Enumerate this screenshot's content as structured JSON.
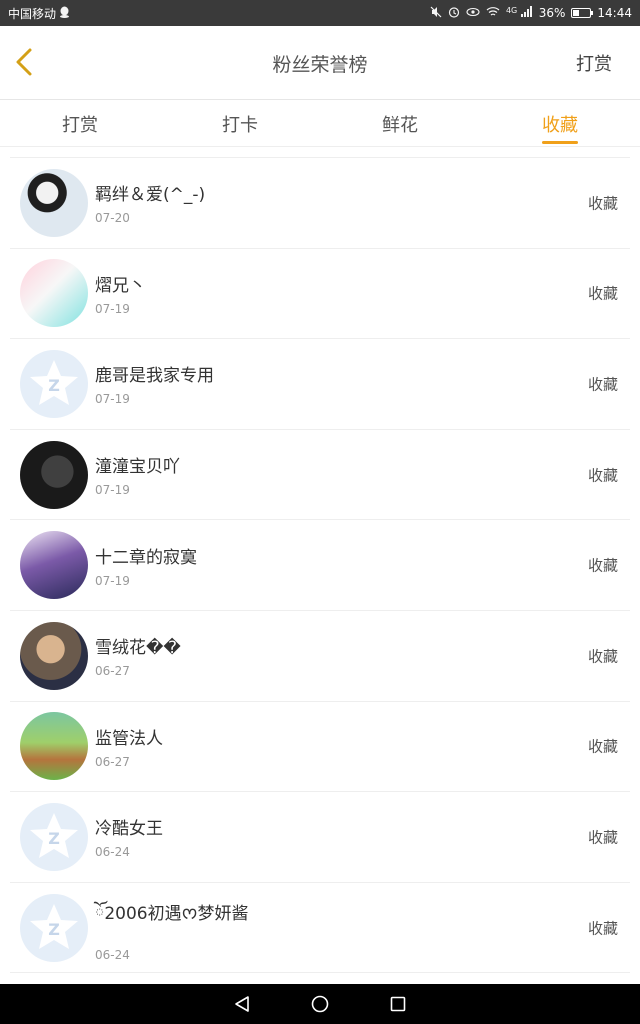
{
  "status_bar": {
    "carrier": "中国移动",
    "battery_percent": "36%",
    "battery_level": 0.36,
    "time": "14:44",
    "signal_label": "4G"
  },
  "header": {
    "title": "粉丝荣誉榜",
    "action": "打赏",
    "back_icon": "chevron-left-icon",
    "back_color": "#d4a017"
  },
  "tabs": [
    {
      "label": "打赏",
      "active": false
    },
    {
      "label": "打卡",
      "active": false
    },
    {
      "label": "鲜花",
      "active": false
    },
    {
      "label": "收藏",
      "active": true
    }
  ],
  "accent_color": "#f0a01a",
  "list": [
    {
      "name": "羁绊＆爱(^_-)",
      "date": "07-20",
      "action": "收藏",
      "avatar": "photo"
    },
    {
      "name": "熠兄丶",
      "date": "07-19",
      "action": "收藏",
      "avatar": "photo"
    },
    {
      "name": "鹿哥是我家专用",
      "date": "07-19",
      "action": "收藏",
      "avatar": "default-qq"
    },
    {
      "name": "潼潼宝贝吖",
      "date": "07-19",
      "action": "收藏",
      "avatar": "photo"
    },
    {
      "name": "十二章的寂寞",
      "date": "07-19",
      "action": "收藏",
      "avatar": "photo"
    },
    {
      "name": "雪绒花��",
      "date": "06-27",
      "action": "收藏",
      "avatar": "photo"
    },
    {
      "name": "监管法人",
      "date": "06-27",
      "action": "收藏",
      "avatar": "photo"
    },
    {
      "name": "冷酷女王",
      "date": "06-24",
      "action": "收藏",
      "avatar": "default-qq"
    },
    {
      "name": "ོ2006初遇ᰔ梦妍酱",
      "date": "06-24",
      "action": "收藏",
      "avatar": "default-qq"
    }
  ],
  "nav": {
    "back_icon": "triangle-back-icon",
    "home_icon": "circle-home-icon",
    "recents_icon": "square-recents-icon"
  }
}
